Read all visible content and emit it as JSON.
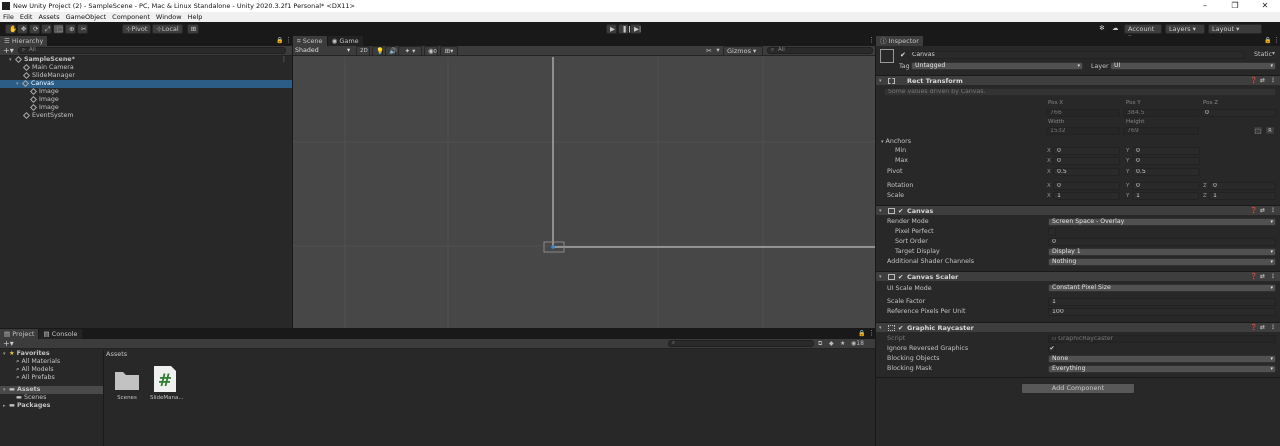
{
  "window": {
    "title": "New Unity Project (2) - SampleScene - PC, Mac & Linux Standalone - Unity 2020.3.2f1 Personal* <DX11>",
    "minimize": "–",
    "restore": "❐",
    "close": "✕"
  },
  "menu": [
    "File",
    "Edit",
    "Assets",
    "GameObject",
    "Component",
    "Window",
    "Help"
  ],
  "toolbar": {
    "pivot": "Pivot",
    "local": "Local",
    "account": "Account",
    "layers": "Layers",
    "layout": "Layout"
  },
  "hierarchy": {
    "tab": "Hierarchy",
    "search_placeholder": "All",
    "items": [
      {
        "label": "SampleScene*",
        "indent": 0,
        "selected": false
      },
      {
        "label": "Main Camera",
        "indent": 1,
        "selected": false
      },
      {
        "label": "SlideManager",
        "indent": 1,
        "selected": false
      },
      {
        "label": "Canvas",
        "indent": 1,
        "selected": true
      },
      {
        "label": "Image",
        "indent": 2,
        "selected": false
      },
      {
        "label": "Image",
        "indent": 2,
        "selected": false
      },
      {
        "label": "Image",
        "indent": 2,
        "selected": false
      },
      {
        "label": "EventSystem",
        "indent": 1,
        "selected": false
      }
    ]
  },
  "scene": {
    "tab_scene": "Scene",
    "tab_game": "Game",
    "shading": "Shaded",
    "mode2d": "2D",
    "gizmos": "Gizmos",
    "search_placeholder": "All",
    "fx_count": "0"
  },
  "project": {
    "tab_project": "Project",
    "tab_console": "Console",
    "favorites_label": "Favorites",
    "favorites": [
      "All Materials",
      "All Models",
      "All Prefabs"
    ],
    "assets_label": "Assets",
    "assets_children": [
      "Scenes"
    ],
    "packages_label": "Packages",
    "breadcrumb": "Assets",
    "count": "18",
    "files": [
      {
        "name": "Scenes",
        "type": "folder"
      },
      {
        "name": "SlideMana...",
        "type": "script"
      }
    ]
  },
  "inspector": {
    "tab": "Inspector",
    "object_name": "Canvas",
    "static_label": "Static",
    "tag_label": "Tag",
    "tag_value": "Untagged",
    "layer_label": "Layer",
    "layer_value": "UI",
    "rect_transform": {
      "title": "Rect Transform",
      "note": "Some values driven by Canvas.",
      "pos_x_label": "Pos X",
      "pos_y_label": "Pos Y",
      "pos_z_label": "Pos Z",
      "pos_x": "766",
      "pos_y": "384.5",
      "pos_z": "0",
      "width_label": "Width",
      "height_label": "Height",
      "width": "1532",
      "height": "769",
      "anchors_label": "Anchors",
      "min_label": "Min",
      "max_label": "Max",
      "min_x": "0",
      "min_y": "0",
      "max_x": "0",
      "max_y": "0",
      "pivot_label": "Pivot",
      "pivot_x": "0.5",
      "pivot_y": "0.5",
      "rotation_label": "Rotation",
      "rot_x": "0",
      "rot_y": "0",
      "rot_z": "0",
      "scale_label": "Scale",
      "scale_x": "1",
      "scale_y": "1",
      "scale_z": "1",
      "x": "X",
      "y": "Y",
      "z": "Z",
      "r": "R"
    },
    "canvas": {
      "title": "Canvas",
      "render_mode_label": "Render Mode",
      "render_mode": "Screen Space - Overlay",
      "pixel_perfect_label": "Pixel Perfect",
      "sort_order_label": "Sort Order",
      "sort_order": "0",
      "target_display_label": "Target Display",
      "target_display": "Display 1",
      "shader_channels_label": "Additional Shader Channels",
      "shader_channels": "Nothing"
    },
    "canvas_scaler": {
      "title": "Canvas Scaler",
      "ui_scale_mode_label": "UI Scale Mode",
      "ui_scale_mode": "Constant Pixel Size",
      "scale_factor_label": "Scale Factor",
      "scale_factor": "1",
      "ref_ppu_label": "Reference Pixels Per Unit",
      "ref_ppu": "100"
    },
    "graphic_raycaster": {
      "title": "Graphic Raycaster",
      "script_label": "Script",
      "script": "GraphicRaycaster",
      "ignore_reversed_label": "Ignore Reversed Graphics",
      "blocking_objects_label": "Blocking Objects",
      "blocking_objects": "None",
      "blocking_mask_label": "Blocking Mask",
      "blocking_mask": "Everything"
    },
    "add_component": "Add Component"
  },
  "colors": {
    "selection": "#2c5d87",
    "scene_bg": "#474747",
    "panel_bg": "#282828",
    "header_bg": "#3e3e3e"
  }
}
